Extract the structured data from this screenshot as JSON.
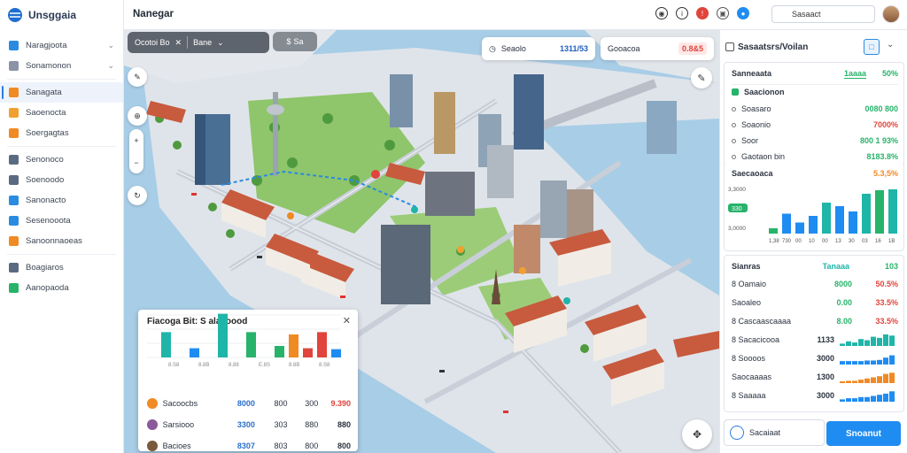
{
  "app": {
    "name": "Unsggaia",
    "page_title": "Nanegar"
  },
  "colors": {
    "accent": "#1f8cf2",
    "green": "#27b36a",
    "red": "#e0443c",
    "teal": "#1fb5a8",
    "orange": "#f08a24"
  },
  "sidebar": {
    "items": [
      {
        "label": "Naragjoota",
        "icon": "layers-icon",
        "color": "#2a8be0",
        "has_chevron": true
      },
      {
        "label": "Sonamonon",
        "icon": "folder-icon",
        "color": "#8a94a6",
        "has_chevron": true
      },
      {
        "label": "Sanagata",
        "icon": "chart-icon",
        "color": "#f08a24"
      },
      {
        "label": "Saoenocta",
        "icon": "bag-icon",
        "color": "#f0a030"
      },
      {
        "label": "Soergagtas",
        "icon": "box-icon",
        "color": "#f08a24"
      },
      {
        "label": "Senonoco",
        "icon": "document-icon",
        "color": "#5a6a80"
      },
      {
        "label": "Soenoodo",
        "icon": "image-icon",
        "color": "#5a6a80"
      },
      {
        "label": "Sanonacto",
        "icon": "shield-icon",
        "color": "#2a8be0"
      },
      {
        "label": "Sesenooota",
        "icon": "tool-icon",
        "color": "#2a8be0"
      },
      {
        "label": "Sanoonnaoeas",
        "icon": "grid-icon",
        "color": "#f08a24"
      },
      {
        "label": "Boagiaros",
        "icon": "mail-icon",
        "color": "#5a6a80"
      },
      {
        "label": "Aanopaoda",
        "icon": "table-icon",
        "color": "#27b36a"
      }
    ]
  },
  "topbar": {
    "icons": [
      {
        "name": "record-icon",
        "color": "#333"
      },
      {
        "name": "info-icon",
        "color": "#333"
      },
      {
        "name": "alert-icon",
        "color": "#e0443c"
      },
      {
        "name": "camera-icon",
        "color": "#555"
      },
      {
        "name": "location-icon",
        "color": "#1f8cf2"
      }
    ],
    "search_value": "Sasaact"
  },
  "map": {
    "toolbar": {
      "label": "Ocotoi Bo",
      "filter": "Bane"
    },
    "chip_label": "Sa",
    "stats": [
      {
        "label": "Seaolo",
        "value": "1311/53",
        "color": "#1f5fc0"
      },
      {
        "label": "Gooacoa",
        "value": "0.8&5",
        "color": "#e0443c"
      }
    ]
  },
  "overlay_card": {
    "title": "Fiacoga Bit: S alacoood",
    "rows": [
      {
        "label": "Sacoocbs",
        "c1": "8000",
        "c2": "800",
        "c3": "300",
        "c4": "9.390",
        "dot": "#f08a24",
        "c4_color": "#e0443c"
      },
      {
        "label": "Sarsiooo",
        "c1": "3300",
        "c2": "303",
        "c3": "880",
        "c4": "880",
        "dot": "#8a5a9a",
        "c4_color": "#2b3340"
      },
      {
        "label": "Bacioes",
        "c1": "8307",
        "c2": "803",
        "c3": "800",
        "c4": "800",
        "dot": "#7a5a3a",
        "c4_color": "#2b3340"
      }
    ]
  },
  "chart_data": {
    "type": "bar",
    "title": "Fiacoga Bit: S alacoood",
    "categories": [
      "",
      "",
      "",
      "",
      "",
      "",
      "",
      "",
      "",
      "",
      "",
      "",
      ""
    ],
    "series": [
      {
        "values": [
          0.55,
          0,
          0.2,
          0,
          0.95,
          0,
          0.55,
          0,
          0.25,
          0.5,
          0.2,
          0.55,
          0.18
        ],
        "colors": [
          "#1fb5a8",
          "#1fb5a8",
          "#1f8cf2",
          "#1fb5a8",
          "#1fb5a8",
          "#27b36a",
          "#27b36a",
          "#27b36a",
          "#27b36a",
          "#f08a24",
          "#e0443c",
          "#e0443c",
          "#1f8cf2"
        ]
      }
    ],
    "x_tick_labels": [
      "8.S8",
      "8.8B",
      "8.88",
      "E.8S",
      "8.8B",
      "8.S8"
    ],
    "ylim": [
      0,
      1
    ]
  },
  "right_panel": {
    "title": "Sasaatsrs/Voilan",
    "summary": {
      "label": "Sanneaata",
      "value": "1aaaa",
      "pct": "50%"
    },
    "list_title": "Saacionon",
    "list": [
      {
        "label": "Soasaro",
        "value": "0080 800",
        "color": "#27b36a"
      },
      {
        "label": "Soaonio",
        "value": "7000%",
        "color": "#e0443c"
      },
      {
        "label": "Soor",
        "value": "800 1 93%",
        "color": "#27b36a"
      },
      {
        "label": "Gaotaon bin",
        "value": "8183.8%",
        "color": "#27b36a"
      }
    ],
    "chart_title": "Saecaoaca",
    "chart_pct": "5.3,5%",
    "chart_y": [
      "3,3000",
      "3,3000",
      "3,0000"
    ],
    "chart_badge": "330",
    "chart_x": [
      "1,38",
      "730",
      "00",
      "10",
      "00",
      "13",
      "30",
      "03",
      "16",
      "1B"
    ],
    "bars": {
      "values": [
        0.12,
        0.45,
        0.25,
        0.4,
        0.7,
        0.62,
        0.5,
        0.9,
        0.98,
        1.0
      ],
      "colors": [
        "#27b36a",
        "#1f8cf2",
        "#1f8cf2",
        "#1f8cf2",
        "#1fb5a8",
        "#1f8cf2",
        "#1f8cf2",
        "#1fb5a8",
        "#27b36a",
        "#1fb5a8"
      ]
    },
    "table_header": {
      "label": "Sianras",
      "mid": "Tanaaa",
      "right": "103"
    },
    "table": [
      {
        "label": "8 Oamaio",
        "v1": "8000",
        "v2": "50.5%",
        "color": "#e0443c",
        "spark": []
      },
      {
        "label": "Saoaleo",
        "v1": "0.00",
        "v2": "33.5%",
        "color": "#e0443c",
        "spark": []
      },
      {
        "label": "8 Cascaascaaaa",
        "v1": "8.00",
        "v2": "33.5%",
        "color": "#e0443c",
        "spark": []
      },
      {
        "label": "8 Sacacicooa",
        "v1": "1133",
        "v2": "",
        "color": "#1fb5a8",
        "spark": [
          0.2,
          0.4,
          0.3,
          0.6,
          0.5,
          0.8,
          0.7,
          1.0,
          0.9
        ]
      },
      {
        "label": "8 Soooos",
        "v1": "3000",
        "v2": "",
        "color": "#1f8cf2",
        "spark": [
          0.3,
          0.3,
          0.3,
          0.3,
          0.35,
          0.35,
          0.4,
          0.6,
          0.8
        ]
      },
      {
        "label": "Saocaaaas",
        "v1": "1300",
        "v2": "",
        "color": "#f08a24",
        "spark": [
          0.1,
          0.2,
          0.2,
          0.3,
          0.4,
          0.5,
          0.6,
          0.8,
          0.9
        ]
      },
      {
        "label": "8 Saaaaa",
        "v1": "3000",
        "v2": "",
        "color": "#1f8cf2",
        "spark": [
          0.2,
          0.3,
          0.3,
          0.4,
          0.4,
          0.5,
          0.6,
          0.7,
          0.9
        ]
      }
    ],
    "footer": {
      "search_label": "Sacaiaat",
      "button": "Snoanut"
    }
  }
}
